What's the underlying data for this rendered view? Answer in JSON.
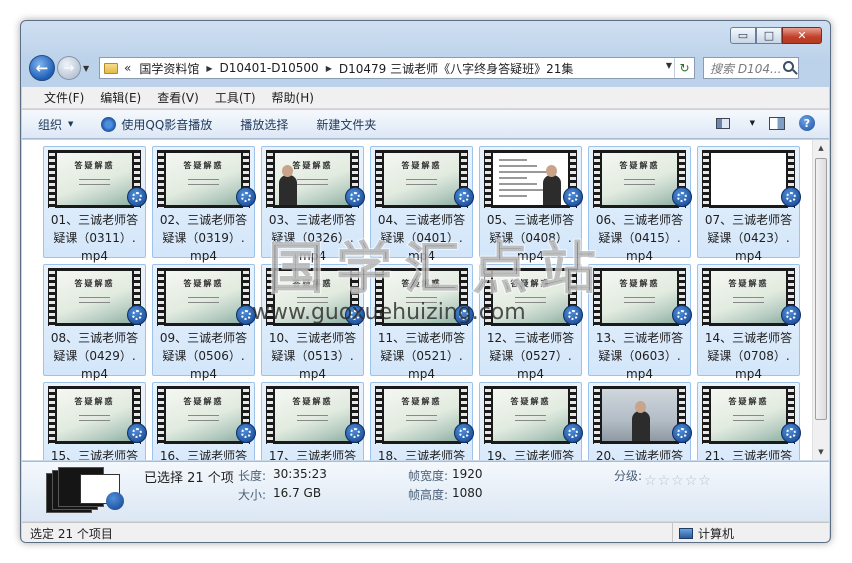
{
  "window": {
    "minimize_glyph": "▭",
    "maximize_glyph": "□",
    "close_glyph": "✕"
  },
  "address": {
    "overflow": "«",
    "crumbs": [
      "国学资料馆",
      "D10401-D10500",
      "D10479 三诚老师《八字终身答疑班》21集"
    ]
  },
  "search": {
    "placeholder": "搜索 D104..."
  },
  "menu": [
    "文件(F)",
    "编辑(E)",
    "查看(V)",
    "工具(T)",
    "帮助(H)"
  ],
  "toolbar": {
    "organize": "组织",
    "play_qq": "使用QQ影音播放",
    "play_selection": "播放选择",
    "new_folder": "新建文件夹"
  },
  "files": [
    {
      "line1": "01、三诚老师答",
      "line2": "疑课（0311）.",
      "line3": "mp4",
      "thumb": "title"
    },
    {
      "line1": "02、三诚老师答",
      "line2": "疑课（0319）.",
      "line3": "mp4",
      "thumb": "title"
    },
    {
      "line1": "03、三诚老师答",
      "line2": "疑课（0326）.",
      "line3": "mp4",
      "thumb": "person-title"
    },
    {
      "line1": "04、三诚老师答",
      "line2": "疑课（0401）.",
      "line3": "mp4",
      "thumb": "title"
    },
    {
      "line1": "05、三诚老师答",
      "line2": "疑课（0408）.",
      "line3": "mp4",
      "thumb": "doc"
    },
    {
      "line1": "06、三诚老师答",
      "line2": "疑课（0415）.",
      "line3": "mp4",
      "thumb": "title"
    },
    {
      "line1": "07、三诚老师答",
      "line2": "疑课（0423）.",
      "line3": "mp4",
      "thumb": "white"
    },
    {
      "line1": "08、三诚老师答",
      "line2": "疑课（0429）.",
      "line3": "mp4",
      "thumb": "title"
    },
    {
      "line1": "09、三诚老师答",
      "line2": "疑课（0506）.",
      "line3": "mp4",
      "thumb": "title"
    },
    {
      "line1": "10、三诚老师答",
      "line2": "疑课（0513）.",
      "line3": "mp4",
      "thumb": "title"
    },
    {
      "line1": "11、三诚老师答",
      "line2": "疑课（0521）.",
      "line3": "mp4",
      "thumb": "title"
    },
    {
      "line1": "12、三诚老师答",
      "line2": "疑课（0527）.",
      "line3": "mp4",
      "thumb": "title"
    },
    {
      "line1": "13、三诚老师答",
      "line2": "疑课（0603）.",
      "line3": "mp4",
      "thumb": "title"
    },
    {
      "line1": "14、三诚老师答",
      "line2": "疑课（0708）.",
      "line3": "mp4",
      "thumb": "title"
    },
    {
      "line1": "15、三诚老师答",
      "line2": "",
      "line3": "",
      "thumb": "title"
    },
    {
      "line1": "16、三诚老师答",
      "line2": "",
      "line3": "",
      "thumb": "title"
    },
    {
      "line1": "17、三诚老师答",
      "line2": "",
      "line3": "",
      "thumb": "title"
    },
    {
      "line1": "18、三诚老师答",
      "line2": "",
      "line3": "",
      "thumb": "title"
    },
    {
      "line1": "19、三诚老师答",
      "line2": "",
      "line3": "",
      "thumb": "title"
    },
    {
      "line1": "20、三诚老师答",
      "line2": "",
      "line3": "",
      "thumb": "photo"
    },
    {
      "line1": "21、三诚老师答",
      "line2": "",
      "line3": "",
      "thumb": "title"
    }
  ],
  "thumb_title_text": "答疑解惑",
  "details": {
    "selected": "已选择 21 个项",
    "length_key": "长度:",
    "length_val": "30:35:23",
    "size_key": "大小:",
    "size_val": "16.7 GB",
    "frame_width_key": "帧宽度:",
    "frame_width_val": "1920",
    "frame_height_key": "帧高度:",
    "frame_height_val": "1080",
    "rating_key": "分级:",
    "rating": 0,
    "rating_max": 5
  },
  "status": {
    "left": "选定 21 个项目",
    "right": "计算机"
  },
  "watermark": {
    "title": "国学汇点站",
    "url": "www.guoxuehuizing.com"
  },
  "colors": {
    "accent": "#1f5fb8",
    "tile_selected": "#d3e6fa",
    "close_button": "#c0402a"
  }
}
